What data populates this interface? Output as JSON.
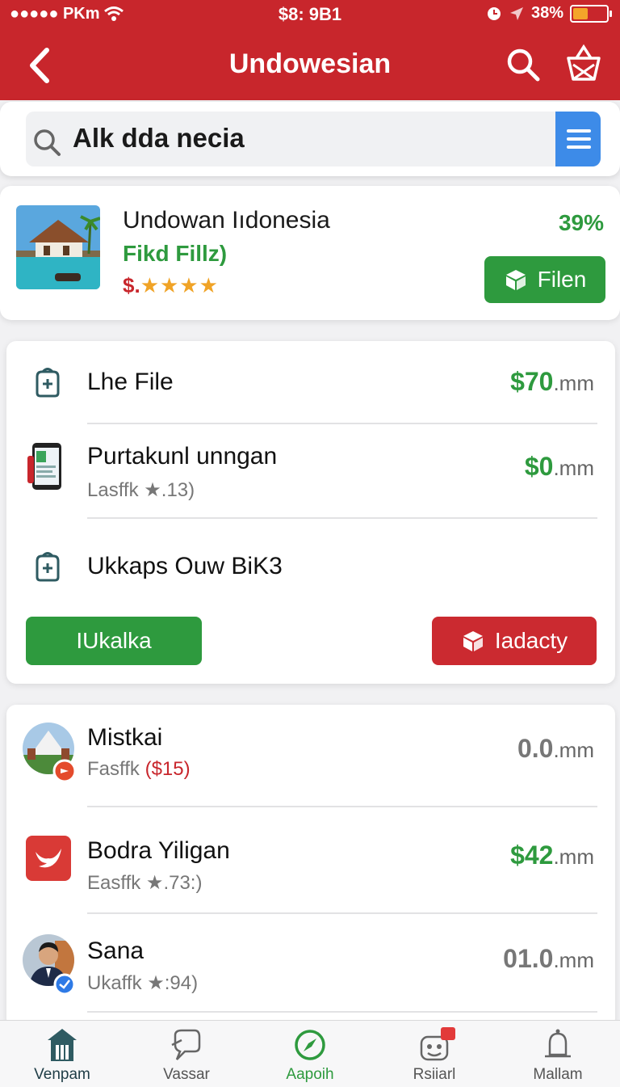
{
  "status_bar": {
    "carrier": "●●●●● PKm",
    "time": "$8: 9B1",
    "battery": "38%"
  },
  "nav": {
    "title": "Undowesian"
  },
  "search": {
    "query": "Alk dda necia"
  },
  "product": {
    "title": "Undowan Iıdonesia",
    "subtitle": "Fikd Fillz)",
    "price_symbol": "$.",
    "stars": "★★★★",
    "percent": "39%",
    "action_label": "Filen"
  },
  "section1": {
    "rows": [
      {
        "title": "Lhe File",
        "price": "$70",
        "unit": ".mm"
      },
      {
        "title": "Purtakunl unngan",
        "sub": "Lasffk ★.13)",
        "price": "$0",
        "unit": ".mm"
      },
      {
        "title": "Ukkaps Ouw BiK3"
      }
    ],
    "primary_label": "IUkalka",
    "secondary_label": "Iadacty"
  },
  "section2": {
    "rows": [
      {
        "title": "Mistkai",
        "sub": "Fasffk",
        "sub_highlight": "($15)",
        "price": "0.0",
        "unit": ".mm"
      },
      {
        "title": "Bodra Yiligan",
        "sub": "Easffk ★.73:)",
        "price": "$42",
        "unit": ".mm"
      },
      {
        "title": "Sana",
        "sub": "Ukaffk ★:94)",
        "price": "01.0",
        "unit": ".mm"
      }
    ]
  },
  "tabs": [
    {
      "label": "Venpam",
      "icon": "store-icon"
    },
    {
      "label": "Vassar",
      "icon": "chat-icon"
    },
    {
      "label": "Aapoih",
      "icon": "compass-icon"
    },
    {
      "label": "Rsiiarl",
      "icon": "bot-icon"
    },
    {
      "label": "Mallam",
      "icon": "bell-icon"
    }
  ],
  "colors": {
    "primary": "#c8262c",
    "accent_green": "#2e9a3e",
    "accent_blue": "#3d8be8"
  }
}
